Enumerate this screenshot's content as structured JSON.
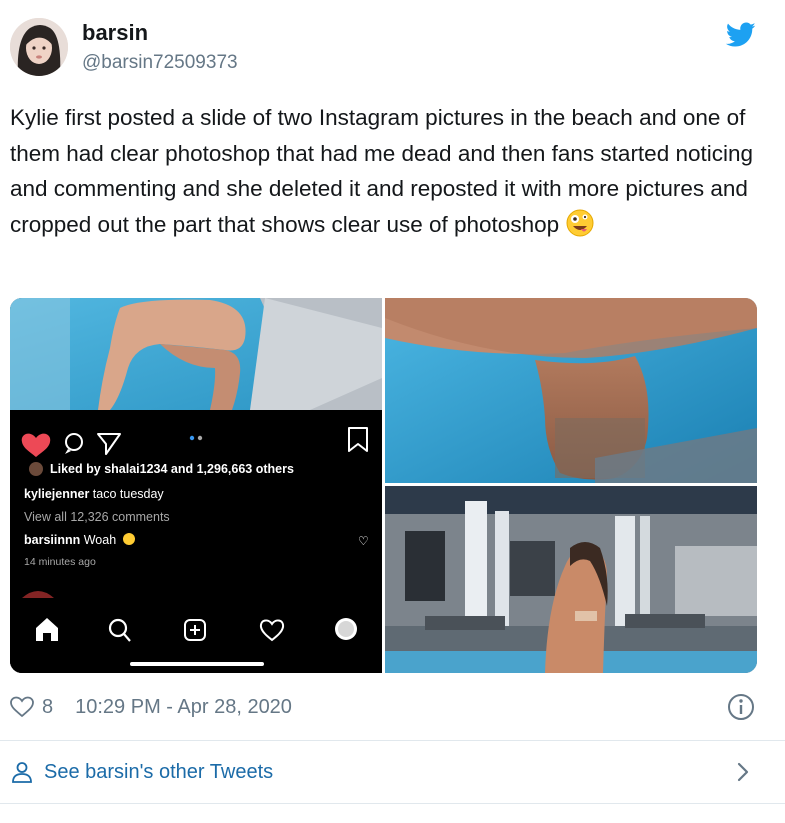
{
  "author": {
    "name": "barsin",
    "handle": "@barsin72509373"
  },
  "tweet": {
    "text": "Kylie first posted a slide of two Instagram pictures in the beach and one of them had clear photoshop that had me dead and then fans started noticing and commenting and she deleted it and reposted it with more pictures and cropped out the part that shows clear use of photoshop",
    "emoji": "zany-face-emoji"
  },
  "instagram_post": {
    "liked_prefix": "Liked by ",
    "liked_user": "shalai1234",
    "liked_and": " and ",
    "liked_count": "1,296,663 others",
    "caption_user": "kyliejenner",
    "caption_text": " taco tuesday",
    "view_comments": "View all 12,326 comments",
    "comment_user": "barsiinnn",
    "comment_text": " Woah",
    "comment_time": "14 minutes ago"
  },
  "meta": {
    "like_count": "8",
    "timestamp": "10:29 PM - Apr 28, 2020"
  },
  "footer": {
    "other_tweets_label": "See barsin's other Tweets"
  },
  "colors": {
    "link_blue": "#1b6ba8",
    "twitter_blue": "#1da1f2",
    "muted_grey": "#657786",
    "heart_red": "#ed4956"
  }
}
